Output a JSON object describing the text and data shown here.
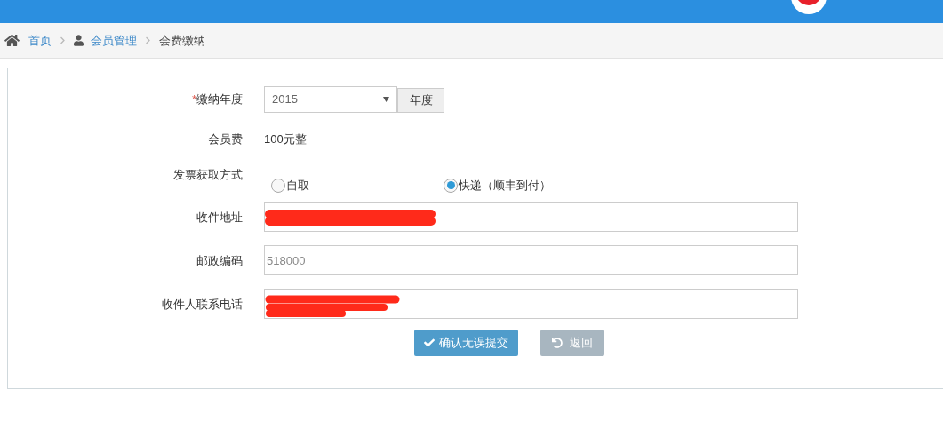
{
  "breadcrumb": [
    {
      "label": "首页",
      "kind": "link"
    },
    {
      "label": "会员管理",
      "kind": "link"
    },
    {
      "label": "会费缴纳",
      "kind": "current"
    }
  ],
  "form": {
    "year": {
      "label": "缴纳年度",
      "required_mark": "*",
      "value": "2015",
      "button": "年度"
    },
    "fee": {
      "label": "会员费",
      "value": "100元整"
    },
    "invoice": {
      "label": "发票获取方式",
      "options": [
        {
          "label": "自取",
          "selected": false
        },
        {
          "label": "快递（顺丰到付）",
          "selected": true
        }
      ]
    },
    "fields": [
      {
        "label": "收件地址",
        "redacted": true
      },
      {
        "label": "邮政编码",
        "placeholder": "518000",
        "redacted": false
      },
      {
        "label": "收件人联系电话",
        "redacted": true
      }
    ],
    "buttons": [
      {
        "label": "确认无误提交",
        "kind": "submit"
      },
      {
        "label": "返回",
        "kind": "back"
      }
    ]
  }
}
